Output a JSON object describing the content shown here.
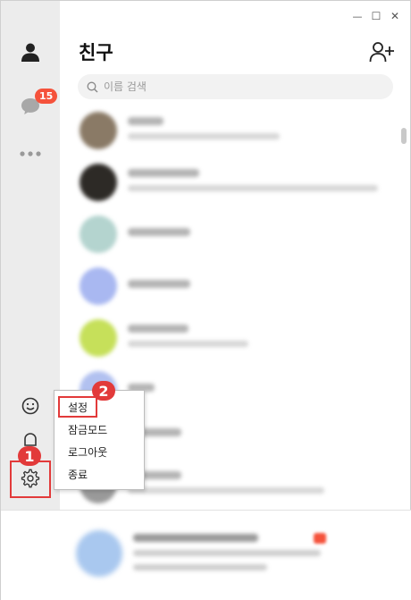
{
  "window": {
    "controls": {
      "minimize": "—",
      "maximize": "☐",
      "close": "✕"
    }
  },
  "rail": {
    "chat_badge": "15",
    "icons": [
      "person-icon",
      "chat-bubble-icon",
      "more-dots-icon",
      "emoji-icon",
      "bell-icon",
      "gear-icon"
    ]
  },
  "header": {
    "title": "친구"
  },
  "search": {
    "placeholder": "이름 검색"
  },
  "friends": {
    "avatar_colors": [
      "#8a7a66",
      "#2d2a26",
      "#b4d4cf",
      "#a9b8f1",
      "#c6e05a",
      "#b2c1f0",
      "#c9c9c9",
      "#9a9a9a"
    ]
  },
  "menu": {
    "items": [
      {
        "label": "설정"
      },
      {
        "label": "잠금모드"
      },
      {
        "label": "로그아웃"
      },
      {
        "label": "종료"
      }
    ]
  },
  "annotations": {
    "step1": "1",
    "step2": "2",
    "color": "#e23a3a"
  }
}
